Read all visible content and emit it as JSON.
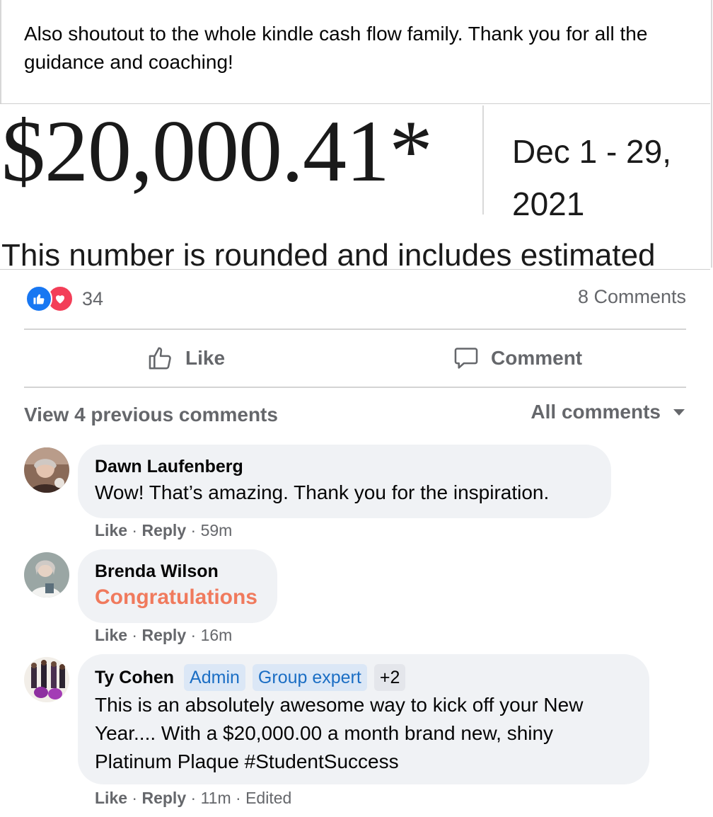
{
  "post": {
    "text": "Also shoutout to the whole kindle cash flow family. Thank you for all the guidance and coaching!"
  },
  "image": {
    "amount": "$20,000.41*",
    "date_range": "Dec 1 - 29, 2021",
    "note": "This number is rounded and includes estimated"
  },
  "reactions": {
    "count": "34",
    "icons": [
      "thumbs-up-icon",
      "heart-icon"
    ],
    "comments_count": "8 Comments"
  },
  "actions": {
    "like_label": "Like",
    "comment_label": "Comment"
  },
  "comments_section": {
    "view_previous": "View 4 previous comments",
    "sort_label": "All comments"
  },
  "comments": [
    {
      "author": "Dawn Laufenberg",
      "text": "Wow! That’s amazing. Thank you for the inspiration.",
      "like": "Like",
      "reply": "Reply",
      "time": "59m"
    },
    {
      "author": "Brenda Wilson",
      "text": "Congratulations",
      "like": "Like",
      "reply": "Reply",
      "time": "16m"
    },
    {
      "author": "Ty Cohen",
      "badges": [
        "Admin",
        "Group expert",
        "+2"
      ],
      "text": "This is an absolutely awesome way to kick off your New Year.... With a $20,000.00 a month brand new, shiny Platinum Plaque #StudentSuccess",
      "like": "Like",
      "reply": "Reply",
      "time": "11m",
      "edited": "Edited"
    }
  ],
  "colors": {
    "secondary_text": "#65676b",
    "bubble_bg": "#f0f2f5",
    "badge_text": "#1b6ec4",
    "badge_bg": "#dbe7f6",
    "like_blue": "#1877f2",
    "love_red": "#f33e58",
    "congrats_text": "#f07a5d"
  }
}
